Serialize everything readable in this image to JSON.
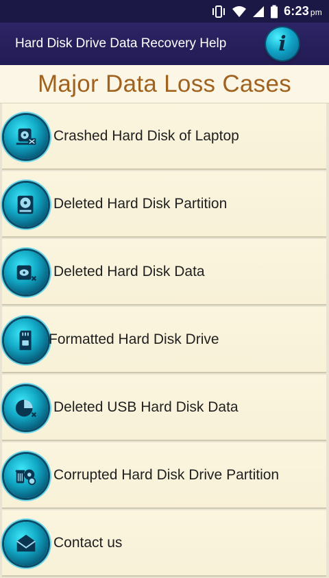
{
  "status_bar": {
    "time": "6:23",
    "ampm": "pm",
    "icons": [
      "vibrate-icon",
      "wifi-icon",
      "signal-icon",
      "battery-icon"
    ]
  },
  "app_bar": {
    "title": "Hard Disk Drive Data Recovery Help",
    "info_icon": "info-icon",
    "info_glyph": "i"
  },
  "page": {
    "title": "Major Data Loss Cases"
  },
  "items": [
    {
      "label": "Crashed Hard Disk of Laptop",
      "icon": "laptop-disk-icon"
    },
    {
      "label": "Deleted Hard Disk Partition",
      "icon": "disk-partition-icon"
    },
    {
      "label": "Deleted Hard Disk Data",
      "icon": "hard-disk-icon"
    },
    {
      "label": "Formatted Hard Disk Drive",
      "icon": "sd-card-icon"
    },
    {
      "label": "Deleted USB Hard Disk Data",
      "icon": "usb-disk-icon"
    },
    {
      "label": "Corrupted Hard Disk Drive Partition",
      "icon": "corrupted-disk-icon"
    },
    {
      "label": "Contact us",
      "icon": "envelope-icon"
    }
  ],
  "colors": {
    "status_bar": "#1b1846",
    "app_bar": "#2d2566",
    "title_text": "#a0621f",
    "list_bg": "#fbf5df",
    "icon_accent": "#12a9c6"
  }
}
